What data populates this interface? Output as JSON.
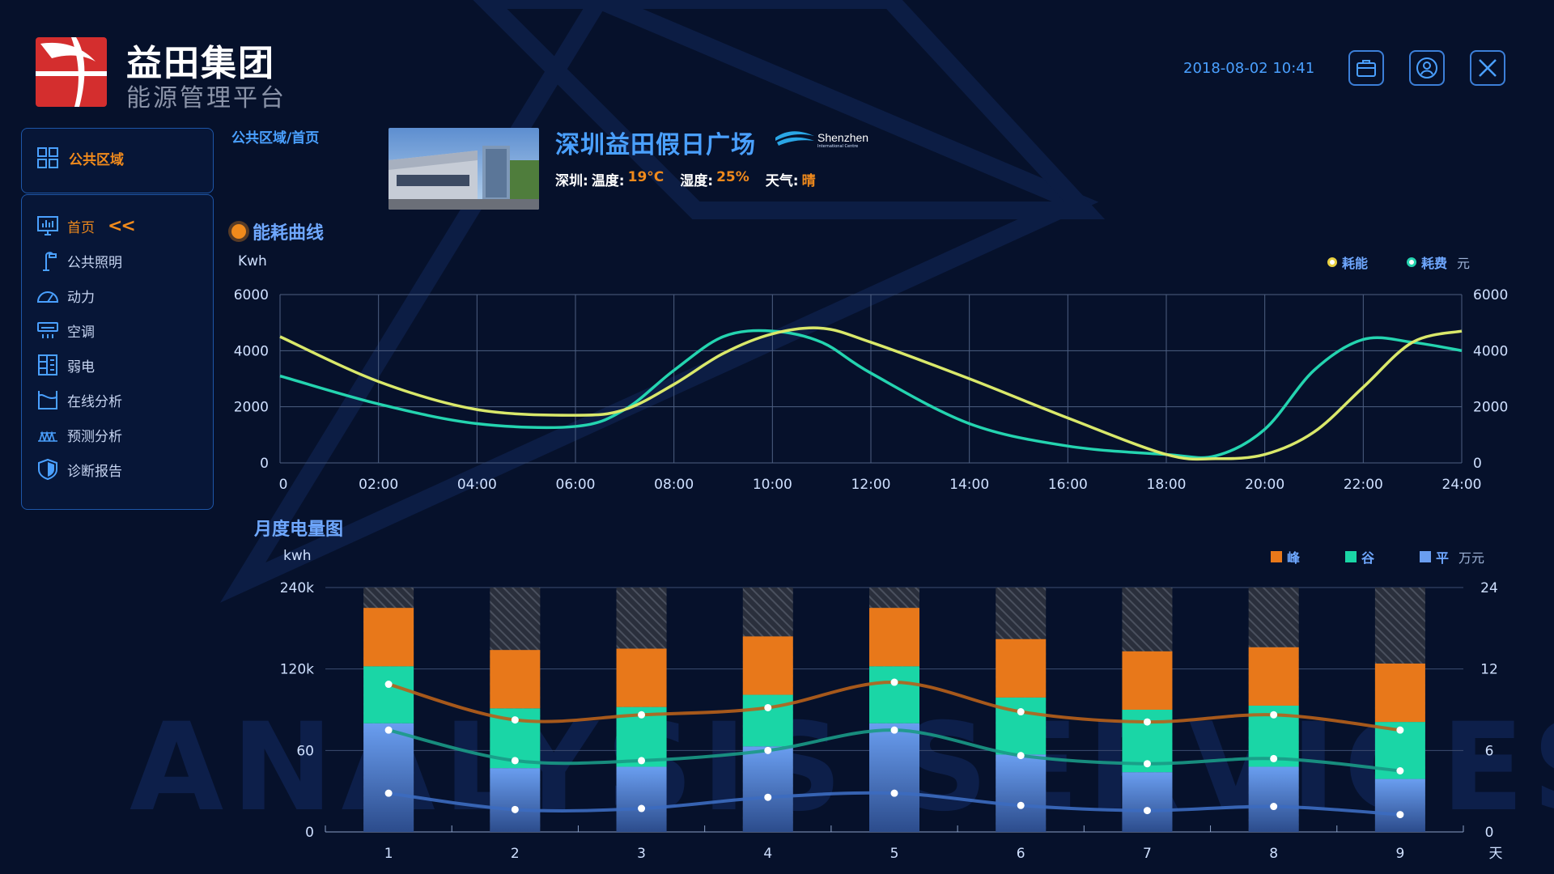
{
  "header": {
    "brand_title": "益田集团",
    "brand_subtitle": "能源管理平台",
    "datetime": "2018-08-02 10:41",
    "buttons": [
      "briefcase-icon",
      "user-icon",
      "close-icon"
    ]
  },
  "sidebar": {
    "area_label": "公共区域",
    "items": [
      {
        "label": "首页",
        "icon": "monitor-chart-icon",
        "active": true
      },
      {
        "label": "公共照明",
        "icon": "street-lamp-icon",
        "active": false
      },
      {
        "label": "动力",
        "icon": "gauge-icon",
        "active": false
      },
      {
        "label": "空调",
        "icon": "air-conditioner-icon",
        "active": false
      },
      {
        "label": "弱电",
        "icon": "panel-icon",
        "active": false
      },
      {
        "label": "在线分析",
        "icon": "analysis-icon",
        "active": false
      },
      {
        "label": "预测分析",
        "icon": "forecast-icon",
        "active": false
      },
      {
        "label": "诊断报告",
        "icon": "shield-icon",
        "active": false
      }
    ],
    "active_marker": "<<"
  },
  "location": {
    "breadcrumb": "公共区域/首页",
    "name": "深圳益田假日广场",
    "partner_logo": "Shenzhen",
    "partner_logo_sub": "International Centre",
    "weather": {
      "city": "深圳:",
      "temp_label": "温度:",
      "temp": "19°C",
      "humidity_label": "湿度:",
      "humidity": "25%",
      "weather_label": "天气:",
      "weather": "晴"
    }
  },
  "colors": {
    "accent_orange": "#f08a1c",
    "accent_blue": "#4aa0ff",
    "energy_line": "#d9e86a",
    "cost_line": "#24d4b0",
    "peak": "#e8781a",
    "valley": "#1ad6a6",
    "flat": "#6a9ef0"
  },
  "watermark": "ANALYSIS SERVICES",
  "chart_data": [
    {
      "type": "line",
      "title": "能耗曲线",
      "ylabel": "Kwh",
      "y2label": "元",
      "x_ticks": [
        "0",
        "02:00",
        "04:00",
        "06:00",
        "08:00",
        "10:00",
        "12:00",
        "14:00",
        "16:00",
        "18:00",
        "20:00",
        "22:00",
        "24:00"
      ],
      "y_ticks": [
        "6000",
        "4000",
        "2000",
        "0"
      ],
      "y2_ticks": [
        "6000",
        "4000",
        "2000",
        "0"
      ],
      "ylim": [
        0,
        6000
      ],
      "xlim": [
        0,
        24
      ],
      "legend_placement": "top-right",
      "series": [
        {
          "name": "耗能",
          "color": "#d9e86a",
          "x": [
            0,
            2,
            4,
            6,
            7,
            8,
            9,
            10,
            11,
            12,
            14,
            16,
            18,
            19,
            20,
            21,
            22,
            23,
            24
          ],
          "values": [
            4500,
            2900,
            1900,
            1700,
            1900,
            2800,
            3900,
            4600,
            4800,
            4300,
            3000,
            1600,
            300,
            150,
            300,
            1100,
            2700,
            4300,
            4700
          ]
        },
        {
          "name": "耗费",
          "color": "#24d4b0",
          "x": [
            0,
            2,
            4,
            6,
            7,
            8,
            9,
            10,
            11,
            12,
            14,
            16,
            18,
            19,
            20,
            21,
            22,
            23,
            24
          ],
          "values": [
            3100,
            2100,
            1400,
            1300,
            1900,
            3300,
            4500,
            4700,
            4300,
            3200,
            1400,
            600,
            300,
            250,
            1200,
            3300,
            4400,
            4300,
            4000
          ]
        }
      ]
    },
    {
      "type": "bar",
      "title": "月度电量图",
      "ylabel": "kwh",
      "y2label": "万元",
      "xlabel": "天",
      "categories": [
        "1",
        "2",
        "3",
        "4",
        "5",
        "6",
        "7",
        "8",
        "9"
      ],
      "y_ticks": [
        "240k",
        "120k",
        "60",
        "0"
      ],
      "y2_ticks": [
        "24",
        "12",
        "6",
        "0"
      ],
      "legend_placement": "top-right",
      "series": [
        {
          "name": "平",
          "color": "#6a9ef0",
          "values": [
            80,
            47,
            48,
            63,
            80,
            57,
            44,
            48,
            39
          ]
        },
        {
          "name": "谷",
          "color": "#1ad6a6",
          "values": [
            42,
            44,
            44,
            38,
            42,
            42,
            46,
            45,
            42
          ]
        },
        {
          "name": "峰",
          "color": "#e8781a",
          "values": [
            43,
            43,
            43,
            43,
            43,
            43,
            43,
            43,
            43
          ]
        }
      ],
      "lines": [
        {
          "name": "峰",
          "color": "#b8601a",
          "values": [
            14.5,
            11,
            11.5,
            12.2,
            14.7,
            11.8,
            10.8,
            11.5,
            10
          ]
        },
        {
          "name": "谷",
          "color": "#1a9a86",
          "values": [
            10,
            7,
            7,
            8,
            10,
            7.5,
            6.7,
            7.2,
            6
          ]
        },
        {
          "name": "平",
          "color": "#3c6cc0",
          "values": [
            3.8,
            2.2,
            2.3,
            3.4,
            3.8,
            2.6,
            2.1,
            2.5,
            1.7
          ]
        }
      ]
    }
  ]
}
